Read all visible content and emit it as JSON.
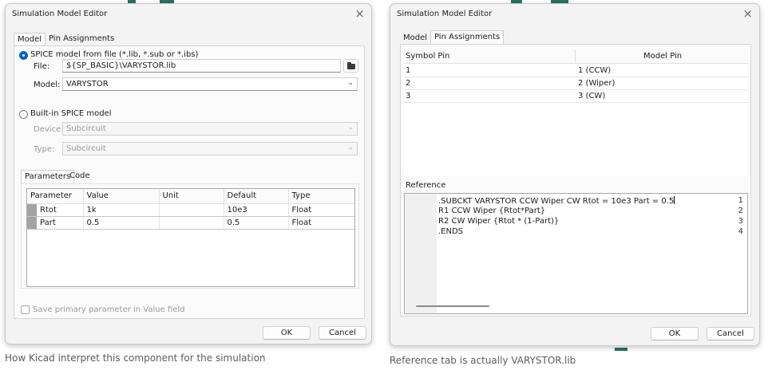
{
  "left_dialog": {
    "title": "Simulation Model Editor",
    "close_glyph": "×",
    "tabs": [
      "Model",
      "Pin Assignments"
    ],
    "active_tab": "Model",
    "spice_file_option": "SPICE model from file (*.lib, *.sub or *.ibs)",
    "file_label": "File:",
    "file_value": "${SP_BASIC}\\VARYSTOR.lib",
    "model_label": "Model:",
    "model_value": "VARYSTOR",
    "builtin_option": "Built-in SPICE model",
    "device_label": "Device:",
    "device_value": "Subcircuit",
    "type_label": "Type:",
    "type_value": "Subcircuit",
    "inner_tabs": [
      "Parameters",
      "Code"
    ],
    "params_columns": [
      "Parameter",
      "Value",
      "Unit",
      "Default",
      "Type"
    ],
    "params_rows": [
      {
        "parameter": "Rtot",
        "value": "1k",
        "unit": "",
        "default": "10e3",
        "type": "Float"
      },
      {
        "parameter": "Part",
        "value": "0.5",
        "unit": "",
        "default": "0.5",
        "type": "Float"
      }
    ],
    "save_primary_label": "Save primary parameter in Value field",
    "ok_label": "OK",
    "cancel_label": "Cancel",
    "caption": "How Kicad interpret this component for the simulation"
  },
  "right_dialog": {
    "title": "Simulation Model Editor",
    "close_glyph": "×",
    "tabs": [
      "Model",
      "Pin Assignments"
    ],
    "active_tab": "Pin Assignments",
    "pin_columns": [
      "Symbol Pin",
      "Model Pin"
    ],
    "pin_rows": [
      {
        "symbol_pin": "1",
        "model_pin": "1 (CCW)"
      },
      {
        "symbol_pin": "2",
        "model_pin": "2 (Wiper)"
      },
      {
        "symbol_pin": "3",
        "model_pin": "3 (CW)"
      }
    ],
    "reference_label": "Reference",
    "code_lines": [
      {
        "n": "1",
        "text": ".SUBCKT VARYSTOR CCW Wiper CW Rtot = 10e3 Part = 0.5"
      },
      {
        "n": "2",
        "text": "R1 CCW Wiper {Rtot*Part}"
      },
      {
        "n": "3",
        "text": "R2 CW Wiper {Rtot * (1-Part)}"
      },
      {
        "n": "4",
        "text": ".ENDS"
      }
    ],
    "ok_label": "OK",
    "cancel_label": "Cancel",
    "caption": "Reference tab is actually VARYSTOR.lib"
  },
  "colors": {
    "dialog_bg": "#f3f3f3",
    "accent": "#0067c0",
    "background_art": "#2a6f62"
  },
  "icons": [
    "close-icon",
    "folder-icon",
    "chevron-down-icon",
    "radio-selected-icon",
    "radio-icon",
    "checkbox-icon",
    "row-handle"
  ]
}
